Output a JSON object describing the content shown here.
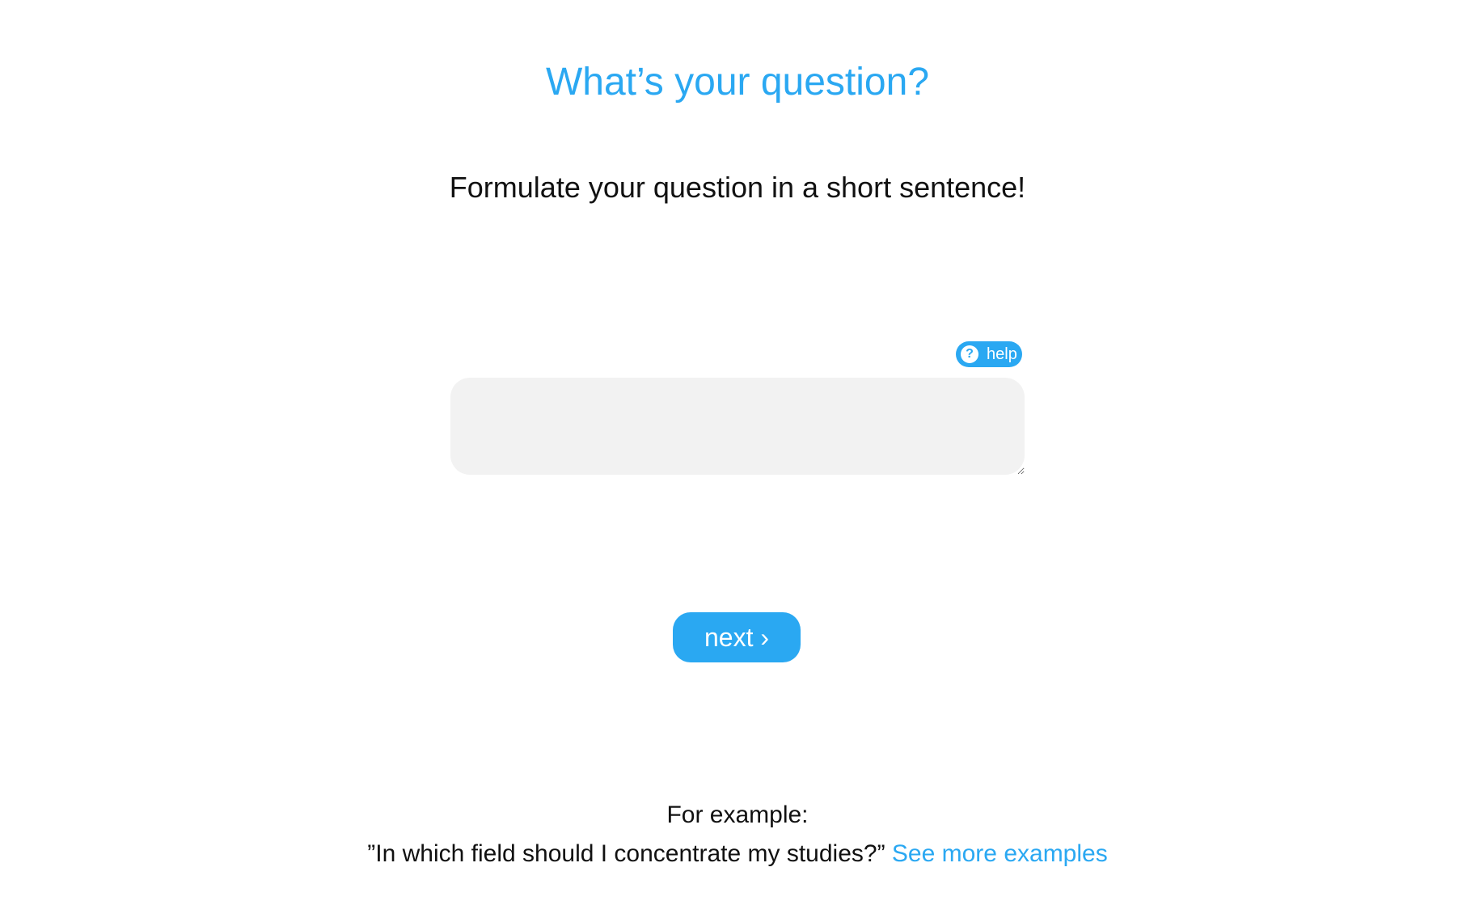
{
  "heading": {
    "title": "What’s your question?",
    "subtitle": "Formulate your question in a short sentence!"
  },
  "help": {
    "icon": "question-circle-icon",
    "icon_glyph": "?",
    "label": "help"
  },
  "question_input": {
    "value": "",
    "placeholder": ""
  },
  "actions": {
    "next_label": "next ›"
  },
  "example": {
    "label": "For example:",
    "quote": "”In which field should I concentrate my studies?”",
    "link_label": "See more examples"
  },
  "colors": {
    "accent": "#2aa8f2",
    "input_background": "#f2f2f2",
    "text": "#111111"
  }
}
